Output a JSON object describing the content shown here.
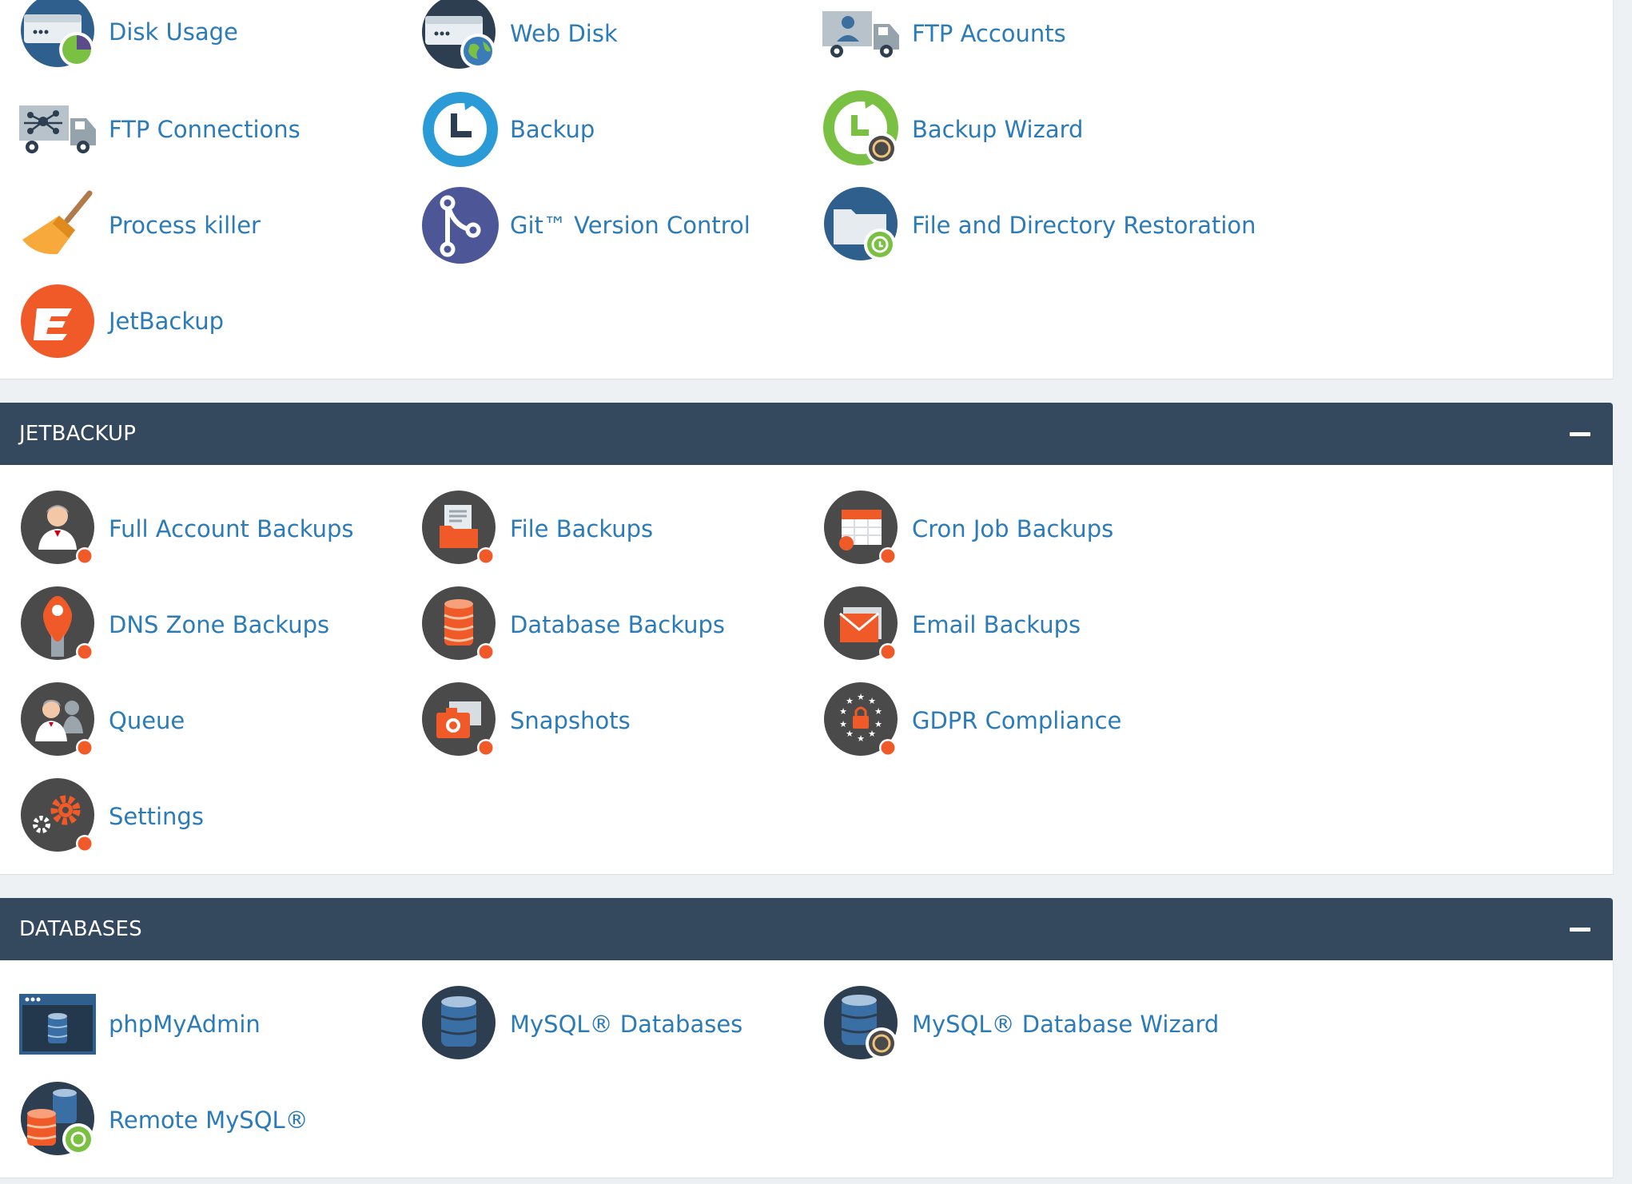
{
  "files_section": {
    "items": [
      {
        "label": "Disk Usage",
        "icon": "disk-usage-icon"
      },
      {
        "label": "Web Disk",
        "icon": "web-disk-icon"
      },
      {
        "label": "FTP Accounts",
        "icon": "ftp-accounts-icon"
      },
      {
        "label": "FTP Connections",
        "icon": "ftp-connections-icon"
      },
      {
        "label": "Backup",
        "icon": "backup-icon"
      },
      {
        "label": "Backup Wizard",
        "icon": "backup-wizard-icon"
      },
      {
        "label": "Process killer",
        "icon": "broom-icon"
      },
      {
        "label": "Git™ Version Control",
        "icon": "git-icon"
      },
      {
        "label": "File and Directory Restoration",
        "icon": "folder-restore-icon"
      },
      {
        "label": "JetBackup",
        "icon": "jetbackup-logo-icon"
      }
    ]
  },
  "jetbackup_section": {
    "title": "JETBACKUP",
    "collapse_icon": "minus-icon",
    "items": [
      {
        "label": "Full Account Backups",
        "icon": "user-backup-icon"
      },
      {
        "label": "File Backups",
        "icon": "file-backup-icon"
      },
      {
        "label": "Cron Job Backups",
        "icon": "calendar-backup-icon"
      },
      {
        "label": "DNS Zone Backups",
        "icon": "map-pin-backup-icon"
      },
      {
        "label": "Database Backups",
        "icon": "database-backup-icon"
      },
      {
        "label": "Email Backups",
        "icon": "envelope-backup-icon"
      },
      {
        "label": "Queue",
        "icon": "queue-users-icon"
      },
      {
        "label": "Snapshots",
        "icon": "camera-icon"
      },
      {
        "label": "GDPR Compliance",
        "icon": "gdpr-stars-lock-icon"
      },
      {
        "label": "Settings",
        "icon": "gears-icon"
      }
    ]
  },
  "databases_section": {
    "title": "DATABASES",
    "collapse_icon": "minus-icon",
    "items": [
      {
        "label": "phpMyAdmin",
        "icon": "phpmyadmin-window-icon"
      },
      {
        "label": "MySQL® Databases",
        "icon": "database-icon"
      },
      {
        "label": "MySQL® Database Wizard",
        "icon": "database-wizard-icon"
      },
      {
        "label": "Remote MySQL®",
        "icon": "remote-database-icon"
      }
    ]
  },
  "colors": {
    "header_bg": "#34495e",
    "link": "#2b7bb9",
    "jetbackup_orange": "#f05a28",
    "page_bg": "#eef1f4"
  }
}
